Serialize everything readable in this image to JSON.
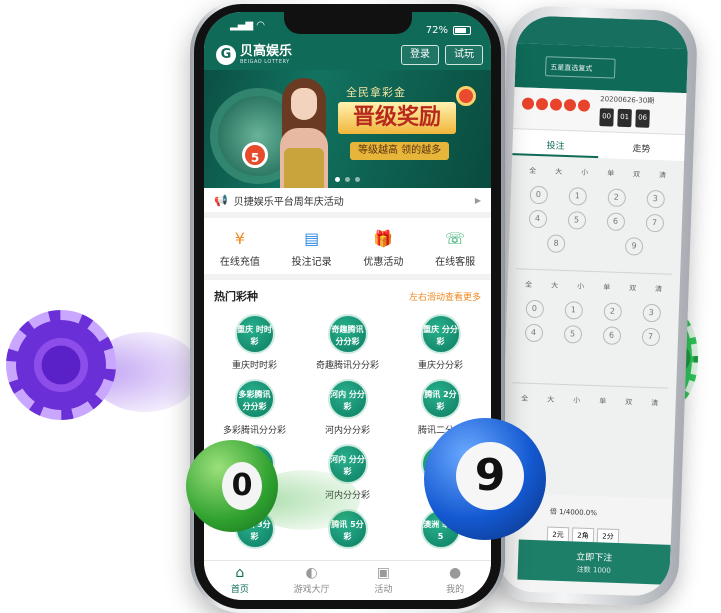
{
  "status_bar": {
    "battery": "72%"
  },
  "header": {
    "logo_letter": "G",
    "app_name": "贝高娱乐",
    "app_subtitle": "BEIGAO LOTTERY",
    "login_label": "登录",
    "trial_label": "试玩"
  },
  "banner": {
    "top_text": "全民拿彩金",
    "headline": "晋级奖励",
    "pill_text": "等级越高 领的越多",
    "ball_number": "5"
  },
  "notice": {
    "text": "贝捷娱乐平台周年庆活动"
  },
  "quick_actions": [
    {
      "label": "在线充值",
      "icon": "yen-coin-icon",
      "color": "#f08a24"
    },
    {
      "label": "投注记录",
      "icon": "document-icon",
      "color": "#2b86e0"
    },
    {
      "label": "优惠活动",
      "icon": "gift-icon",
      "color": "#e2453a"
    },
    {
      "label": "在线客服",
      "icon": "headset-chat-icon",
      "color": "#18a35a"
    }
  ],
  "hot_games": {
    "title": "热门彩种",
    "more": "左右滑动查看更多",
    "items": [
      {
        "label": "重庆时时彩",
        "badge": "重庆 时时彩"
      },
      {
        "label": "奇趣腾讯分分彩",
        "badge": "奇趣腾讯 分分彩"
      },
      {
        "label": "重庆分分彩",
        "badge": "重庆 分分彩"
      },
      {
        "label": "多彩腾讯分分彩",
        "badge": "多彩腾讯 分分彩"
      },
      {
        "label": "河内分分彩",
        "badge": "河内 分分彩"
      },
      {
        "label": "腾讯二分彩",
        "badge": "腾讯 2分彩"
      },
      {
        "label": "",
        "badge": ""
      },
      {
        "label": "河内分分彩",
        "badge": "河内 分分彩"
      },
      {
        "label": "",
        "badge": ""
      },
      {
        "label": "",
        "badge": "腾讯 3分彩"
      },
      {
        "label": "",
        "badge": "腾讯 5分彩"
      },
      {
        "label": "",
        "badge": "澳洲 幸运5"
      }
    ]
  },
  "tabbar": [
    {
      "label": "首页",
      "icon": "home-icon",
      "active": true
    },
    {
      "label": "游戏大厅",
      "icon": "gamepad-icon",
      "active": false
    },
    {
      "label": "活动",
      "icon": "gift-icon",
      "active": false
    },
    {
      "label": "我的",
      "icon": "user-icon",
      "active": false
    }
  ],
  "back_phone": {
    "select_label": "五星直选复式",
    "issue_label": "20200626-30期",
    "issue_label_2": "20200626-30期",
    "countdown": [
      "00",
      "01",
      "06"
    ],
    "tab_bet": "投注",
    "tab_trend": "走势",
    "col_heads": [
      "全",
      "大",
      "小",
      "单",
      "双",
      "清"
    ],
    "digits": [
      "0",
      "1",
      "2",
      "3",
      "4",
      "5",
      "6",
      "7",
      "8",
      "9"
    ],
    "multiplier_label": "倍",
    "multiplier_value": "1/4000.0%",
    "units": [
      "2元",
      "2角",
      "2分"
    ],
    "submit_label": "立即下注",
    "submit_sub": "注数 1000"
  },
  "decor": {
    "green_ball_number": "0",
    "blue_ball_number": "9"
  }
}
